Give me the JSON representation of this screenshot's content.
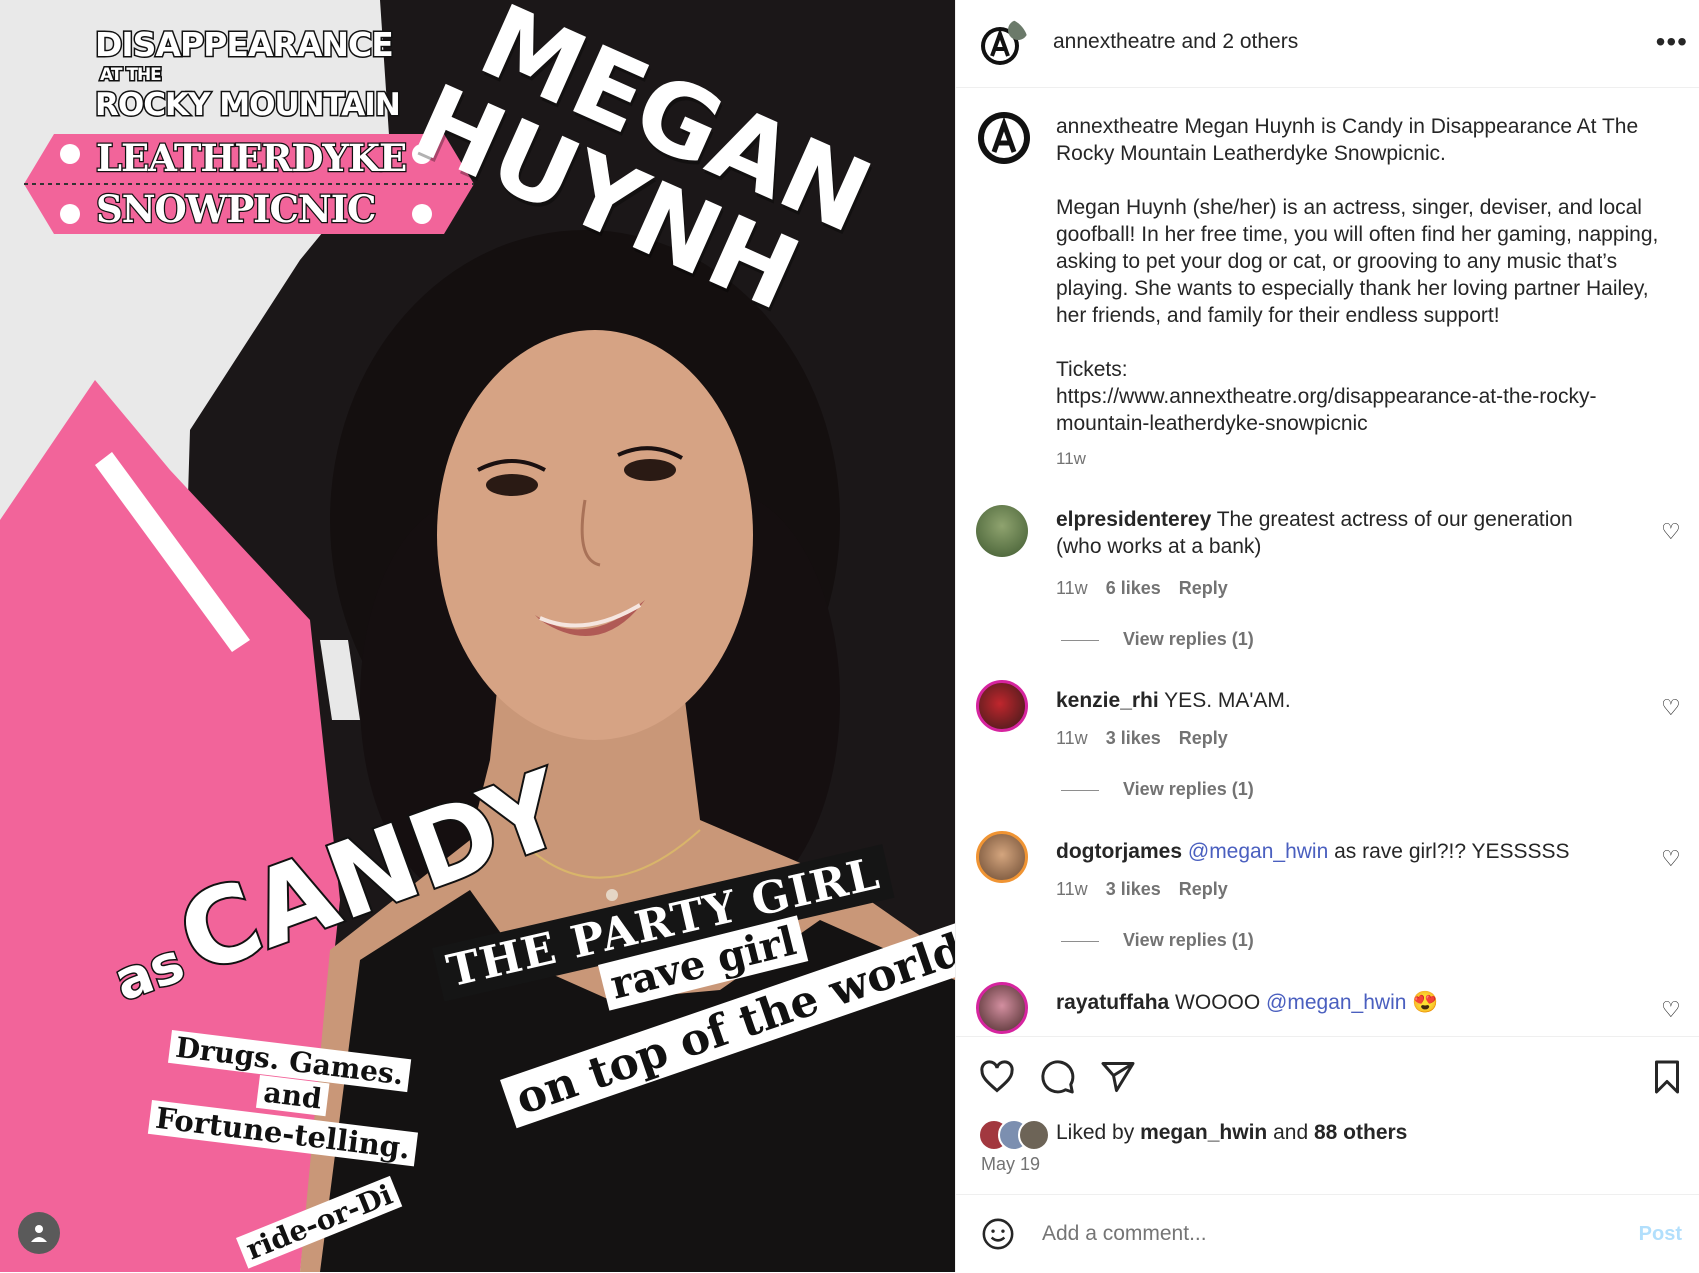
{
  "poster": {
    "title_line1": "DISAPPEARANCE",
    "title_line2": "AT THE",
    "title_line3": "ROCKY MOUNTAIN",
    "plate_line1": "LEATHERDYKE",
    "plate_line2": "SNOWPICNIC",
    "name_line1": "MEGAN",
    "name_line2": "HUYNH",
    "as_word": "as",
    "role": "CANDY",
    "strip_party": "THE PARTY GIRL",
    "strip_rave": "rave girl",
    "strip_world": "on top of the world",
    "strip_drugs": "Drugs. Games.",
    "strip_and": "and",
    "strip_fortune": "Fortune-telling.",
    "strip_ride": "ride-or-Di"
  },
  "header": {
    "username": "annextheatre",
    "and_text": " and ",
    "others": "2 others",
    "more_icon": "more-dots-icon"
  },
  "caption": {
    "username": "annextheatre",
    "line1": " Megan Huynh is Candy in Disappearance At The Rocky Mountain Leatherdyke Snowpicnic.",
    "para2": "Megan Huynh (she/her) is an actress, singer, deviser, and local goofball! In her free time, you will often find her gaming, napping, asking to pet your dog or cat, or grooving to any music that’s playing. She wants to especially thank her loving partner Hailey, her friends, and family for their endless support!",
    "tickets_label": "Tickets:",
    "tickets_url": "https://www.annextheatre.org/disappearance-at-the-rocky-mountain-leatherdyke-snowpicnic",
    "time": "11w"
  },
  "comments": [
    {
      "username": "elpresidenterey",
      "text": " The greatest actress of our generation (who works at a bank)",
      "time": "11w",
      "likes": "6 likes",
      "reply": "Reply",
      "view_replies": "View replies (1)"
    },
    {
      "username": "kenzie_rhi",
      "text": " YES. MA'AM.",
      "time": "11w",
      "likes": "3 likes",
      "reply": "Reply",
      "view_replies": "View replies (1)"
    },
    {
      "username": "dogtorjames",
      "mention": "@megan_hwin",
      "text": " as rave girl?!? YESSSSS",
      "time": "11w",
      "likes": "3 likes",
      "reply": "Reply",
      "view_replies": "View replies (1)"
    },
    {
      "username": "rayatuffaha",
      "pre": " WOOOO ",
      "mention": "@megan_hwin",
      "emoji": "😍"
    }
  ],
  "actions": {
    "liked_prefix": "Liked by ",
    "liked_user": "megan_hwin",
    "liked_and": " and ",
    "liked_others": "88 others",
    "date": "May 19"
  },
  "add_comment": {
    "placeholder": "Add a comment...",
    "post": "Post"
  },
  "colors": {
    "pink": "#f2649a",
    "dark": "#1b1718",
    "mention": "#4a5fbf",
    "post_disabled": "#b2dffc"
  }
}
